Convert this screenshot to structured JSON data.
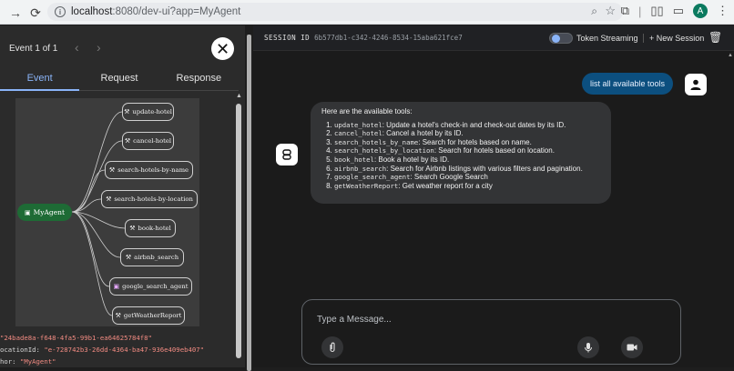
{
  "browser": {
    "url_host": "localhost",
    "url_path": ":8080/dev-ui?app=MyAgent",
    "profile_initial": "A"
  },
  "left_panel": {
    "event_count": "Event 1 of 1",
    "tabs": [
      "Event",
      "Request",
      "Response"
    ],
    "active_tab": "Event",
    "graph": {
      "root": "MyAgent",
      "nodes": [
        {
          "label": "update-hotel",
          "icon": "wrench-icon"
        },
        {
          "label": "cancel-hotel",
          "icon": "wrench-icon"
        },
        {
          "label": "search-hotels-by-name",
          "icon": "wrench-icon"
        },
        {
          "label": "search-hotels-by-location",
          "icon": "wrench-icon"
        },
        {
          "label": "book-hotel",
          "icon": "wrench-icon"
        },
        {
          "label": "airbnb_search",
          "icon": "wrench-icon"
        },
        {
          "label": "google_search_agent",
          "icon": "robot-icon"
        },
        {
          "label": "getWeatherReport",
          "icon": "wrench-icon"
        }
      ]
    },
    "json_lines": [
      {
        "key": "",
        "value": "\"24bade8a-f648-4fa5-99b1-ea64625784f8\""
      },
      {
        "key": "ocationId: ",
        "value": "\"e-728742b3-26dd-4364-ba47-936e409eb407\""
      },
      {
        "key": "hor: ",
        "value": "\"MyAgent\""
      }
    ]
  },
  "right_panel": {
    "session_label": "SESSION ID",
    "session_id": "6b577db1-c342-4246-8534-15aba621fce7",
    "token_streaming_label": "Token Streaming",
    "new_session_label": "New Session",
    "user_message": "list all available tools",
    "bot_intro": "Here are the available tools:",
    "tools": [
      {
        "name": "update_hotel",
        "desc": ": Update a hotel's check-in and check-out dates by its ID."
      },
      {
        "name": "cancel_hotel",
        "desc": ": Cancel a hotel by its ID."
      },
      {
        "name": "search_hotels_by_name",
        "desc": ": Search for hotels based on name."
      },
      {
        "name": "search_hotels_by_location",
        "desc": ": Search for hotels based on location."
      },
      {
        "name": "book_hotel",
        "desc": ": Book a hotel by its ID."
      },
      {
        "name": "airbnb_search",
        "desc": ": Search for Airbnb listings with various filters and pagination."
      },
      {
        "name": "google_search_agent",
        "desc": ": Search Google Search"
      },
      {
        "name": "getWeatherReport",
        "desc": ": Get weather report for a city"
      }
    ],
    "composer_placeholder": "Type a Message..."
  }
}
